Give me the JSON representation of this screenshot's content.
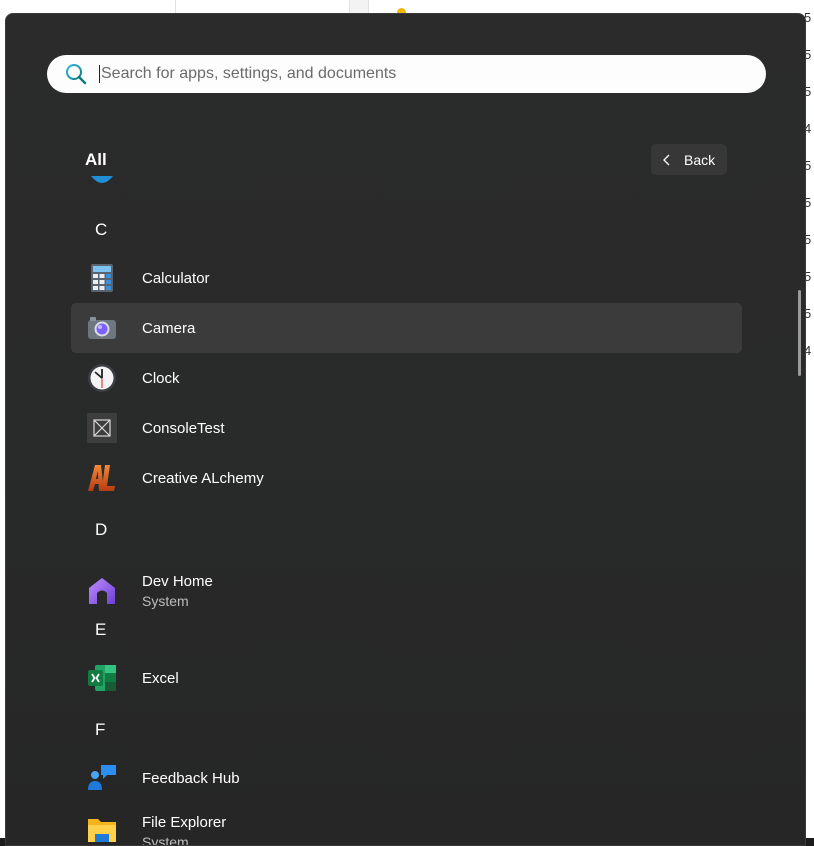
{
  "background": {
    "right_numbers": [
      "5",
      "5",
      "5",
      "4",
      "5",
      "5",
      "5",
      "5",
      "5",
      "4"
    ]
  },
  "search": {
    "placeholder": "Search for apps, settings, and documents",
    "value": ""
  },
  "header": {
    "title": "All",
    "back_label": "Back"
  },
  "sections": [
    {
      "letter": "C",
      "apps": [
        {
          "name": "Calculator",
          "subtitle": "",
          "icon": "calculator-icon"
        },
        {
          "name": "Camera",
          "subtitle": "",
          "icon": "camera-icon",
          "selected": true
        },
        {
          "name": "Clock",
          "subtitle": "",
          "icon": "clock-icon"
        },
        {
          "name": "ConsoleTest",
          "subtitle": "",
          "icon": "console-test-icon"
        },
        {
          "name": "Creative ALchemy",
          "subtitle": "",
          "icon": "creative-alchemy-icon"
        }
      ]
    },
    {
      "letter": "D",
      "apps": [
        {
          "name": "Dev Home",
          "subtitle": "System",
          "icon": "dev-home-icon"
        }
      ]
    },
    {
      "letter": "E",
      "apps": [
        {
          "name": "Excel",
          "subtitle": "",
          "icon": "excel-icon"
        }
      ]
    },
    {
      "letter": "F",
      "apps": [
        {
          "name": "Feedback Hub",
          "subtitle": "",
          "icon": "feedback-hub-icon"
        },
        {
          "name": "File Explorer",
          "subtitle": "System",
          "icon": "file-explorer-icon"
        }
      ]
    }
  ],
  "colors": {
    "menu_background": "#2a2a2a",
    "selected_row": "#3b3b3b",
    "accent": "#0067c0"
  }
}
